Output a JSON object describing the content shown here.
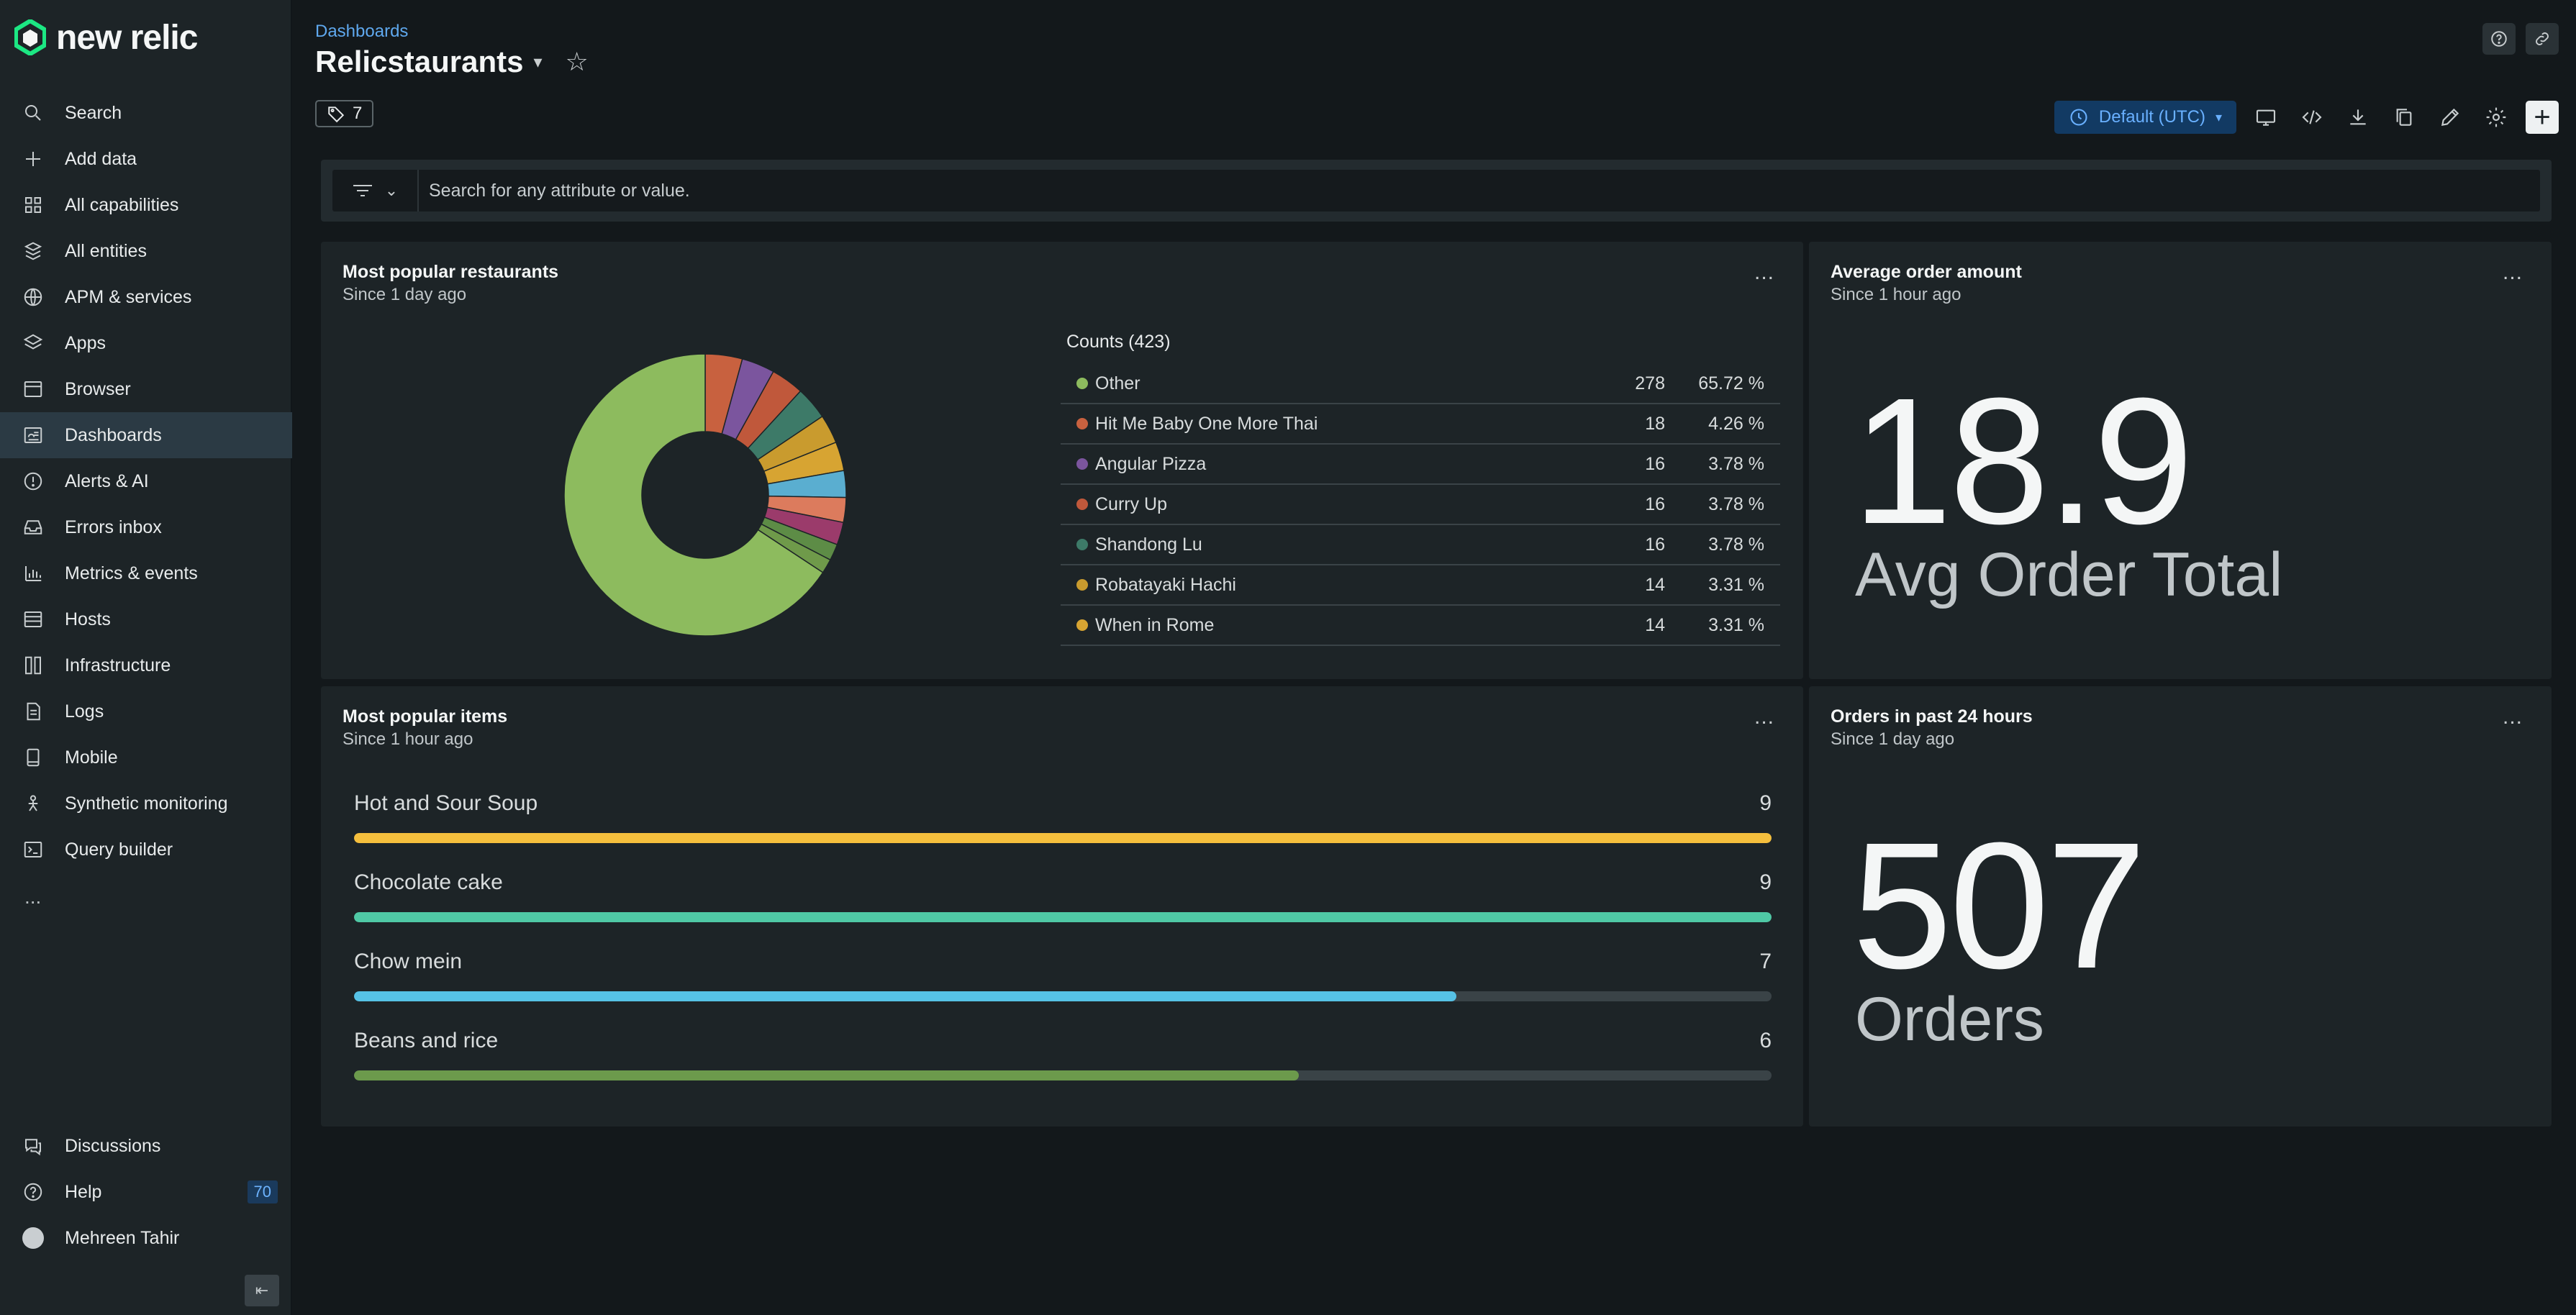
{
  "app": {
    "logo_text": "new relic"
  },
  "sidebar": {
    "items": [
      {
        "label": "Search",
        "icon": "search-icon"
      },
      {
        "label": "Add data",
        "icon": "plus-icon"
      },
      {
        "label": "All capabilities",
        "icon": "grid-icon"
      },
      {
        "label": "All entities",
        "icon": "entities-icon"
      },
      {
        "label": "APM & services",
        "icon": "globe-icon"
      },
      {
        "label": "Apps",
        "icon": "layers-icon"
      },
      {
        "label": "Browser",
        "icon": "browser-icon"
      },
      {
        "label": "Dashboards",
        "icon": "dashboard-icon",
        "active": true
      },
      {
        "label": "Alerts & AI",
        "icon": "alert-icon"
      },
      {
        "label": "Errors inbox",
        "icon": "inbox-icon"
      },
      {
        "label": "Metrics & events",
        "icon": "bar-chart-icon"
      },
      {
        "label": "Hosts",
        "icon": "server-icon"
      },
      {
        "label": "Infrastructure",
        "icon": "infrastructure-icon"
      },
      {
        "label": "Logs",
        "icon": "logs-icon"
      },
      {
        "label": "Mobile",
        "icon": "mobile-icon"
      },
      {
        "label": "Synthetic monitoring",
        "icon": "robot-icon"
      },
      {
        "label": "Query builder",
        "icon": "terminal-icon"
      }
    ],
    "more": "...",
    "bottom": {
      "discussions": "Discussions",
      "help": "Help",
      "help_badge": "70",
      "user": "Mehreen Tahir"
    }
  },
  "header": {
    "breadcrumb": "Dashboards",
    "title": "Relicstaurants",
    "tag_count": "7",
    "timezone": "Default (UTC)"
  },
  "filter": {
    "placeholder": "Search for any attribute or value."
  },
  "widgets": {
    "restaurants": {
      "title": "Most popular restaurants",
      "subtitle": "Since 1 day ago",
      "menu": "...",
      "legend_title": "Counts (423)"
    },
    "avg_order": {
      "title": "Average order amount",
      "subtitle": "Since 1 hour ago",
      "menu": "...",
      "value": "18.9",
      "label": "Avg Order Total"
    },
    "items": {
      "title": "Most popular items",
      "subtitle": "Since 1 hour ago",
      "menu": "..."
    },
    "orders": {
      "title": "Orders in past 24 hours",
      "subtitle": "Since 1 day ago",
      "menu": "...",
      "value": "507",
      "label": "Orders"
    }
  },
  "chart_data": [
    {
      "type": "pie",
      "title": "Most popular restaurants",
      "total": 423,
      "slices": [
        {
          "name": "Other",
          "value": 278,
          "pct": "65.72 %",
          "color": "#8dbb5e"
        },
        {
          "name": "Hit Me Baby One More Thai",
          "value": 18,
          "pct": "4.26 %",
          "color": "#c8613f"
        },
        {
          "name": "Angular Pizza",
          "value": 16,
          "pct": "3.78 %",
          "color": "#7b559e"
        },
        {
          "name": "Curry Up",
          "value": 16,
          "pct": "3.78 %",
          "color": "#c0583b"
        },
        {
          "name": "Shandong Lu",
          "value": 16,
          "pct": "3.78 %",
          "color": "#3d7a68"
        },
        {
          "name": "Robatayaki Hachi",
          "value": 14,
          "pct": "3.31 %",
          "color": "#c99b2e"
        },
        {
          "name": "When in Rome",
          "value": 14,
          "pct": "3.31 %",
          "color": "#d7a432"
        }
      ],
      "hidden_slices": [
        {
          "value": 13,
          "color": "#5aaed0"
        },
        {
          "value": 12,
          "color": "#dc7b5d"
        },
        {
          "value": 11,
          "color": "#9b3b6b"
        },
        {
          "value": 8,
          "color": "#5d8c46"
        },
        {
          "value": 7,
          "color": "#6f9a4a"
        }
      ]
    },
    {
      "type": "bar",
      "title": "Most popular items",
      "max": 9,
      "categories": [
        "Hot and Sour Soup",
        "Chocolate cake",
        "Chow mein",
        "Beans and rice"
      ],
      "values": [
        9,
        9,
        7,
        6
      ],
      "colors": [
        "#f5bf3d",
        "#4fc9a5",
        "#56c2e6",
        "#6c9a4c"
      ]
    }
  ]
}
